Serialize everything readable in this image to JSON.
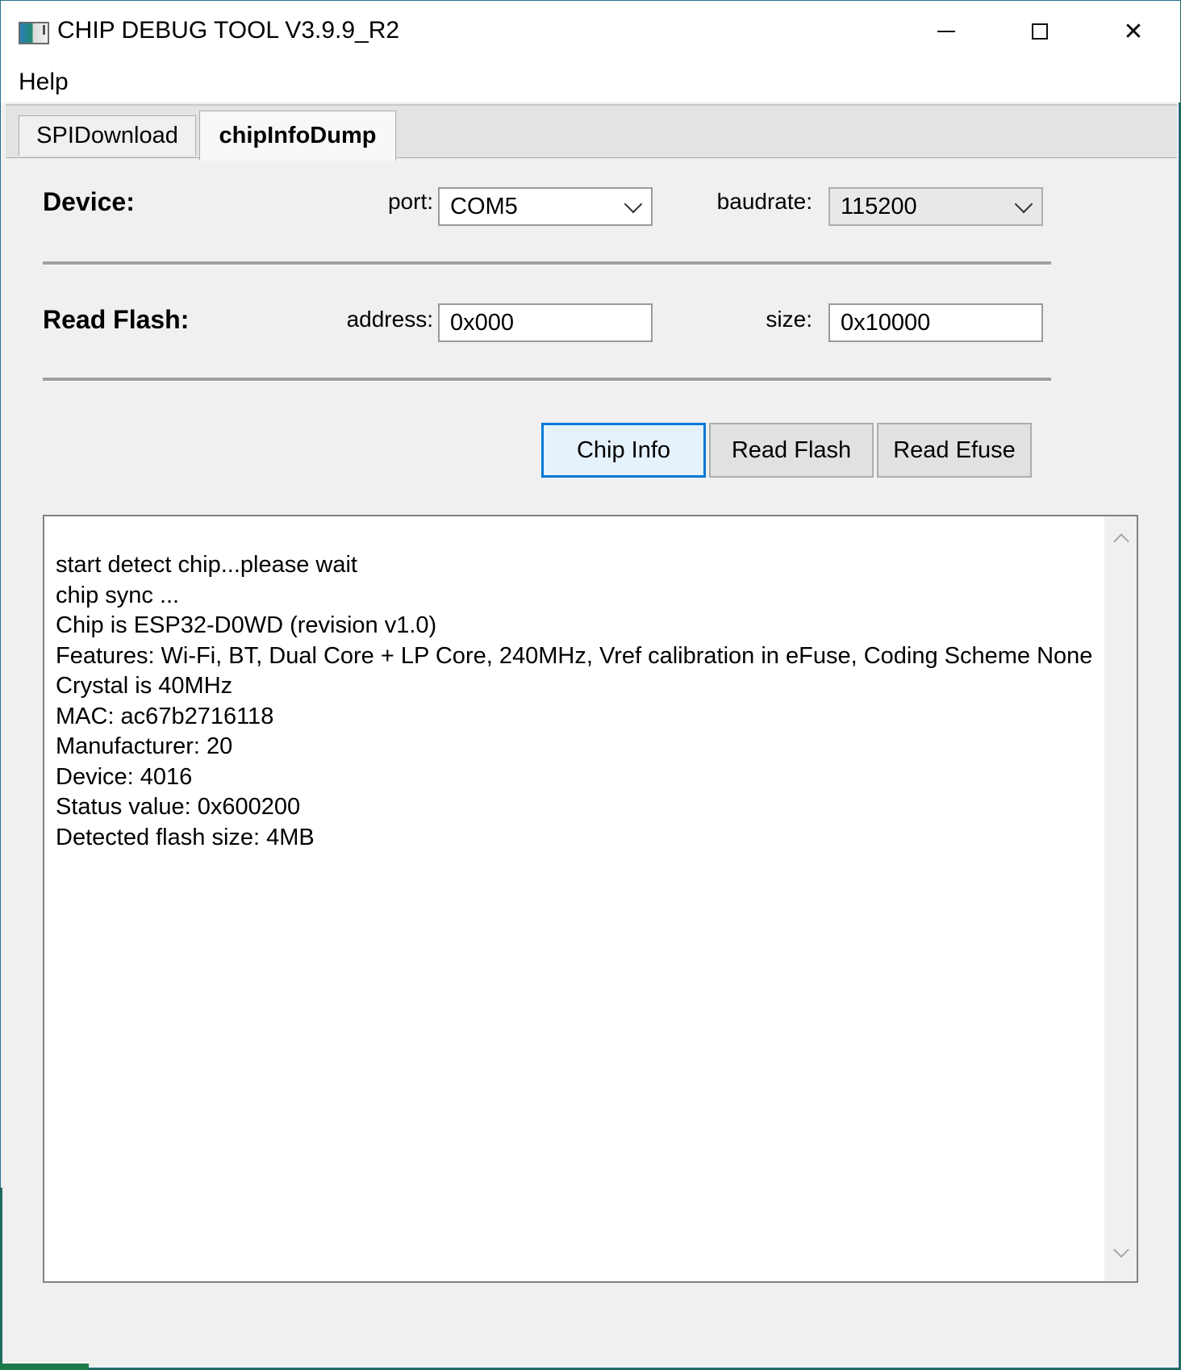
{
  "window": {
    "title": "CHIP DEBUG TOOL V3.9.9_R2",
    "app_icon": "app-icon",
    "controls": {
      "minimize": "minimize-icon",
      "maximize": "maximize-icon",
      "close": "close-icon",
      "close_glyph": "✕"
    }
  },
  "menu": {
    "items": [
      {
        "label": "Help"
      }
    ]
  },
  "tabs": [
    {
      "label": "SPIDownload",
      "active": false
    },
    {
      "label": "chipInfoDump",
      "active": true
    }
  ],
  "device": {
    "section_label": "Device:",
    "port_label": "port:",
    "port_value": "COM5",
    "baudrate_label": "baudrate:",
    "baudrate_value": "115200"
  },
  "read_flash": {
    "section_label": "Read Flash:",
    "address_label": "address:",
    "address_value": "0x000",
    "size_label": "size:",
    "size_value": "0x10000"
  },
  "actions": {
    "chip_info": "Chip Info",
    "read_flash": "Read Flash",
    "read_efuse": "Read Efuse"
  },
  "log": {
    "lines": [
      "start detect chip...please wait",
      "chip sync ...",
      "Chip is ESP32-D0WD (revision v1.0)",
      "Features: Wi-Fi, BT, Dual Core + LP Core, 240MHz, Vref calibration in eFuse, Coding Scheme None",
      "Crystal is 40MHz",
      "MAC: ac67b2716118",
      "Manufacturer: 20",
      "Device: 4016",
      "Status value: 0x600200",
      "Detected flash size: 4MB"
    ]
  },
  "colors": {
    "focus_accent": "#0078d7",
    "window_bg": "#f0f0f0",
    "desktop": "#1e6b5a"
  }
}
